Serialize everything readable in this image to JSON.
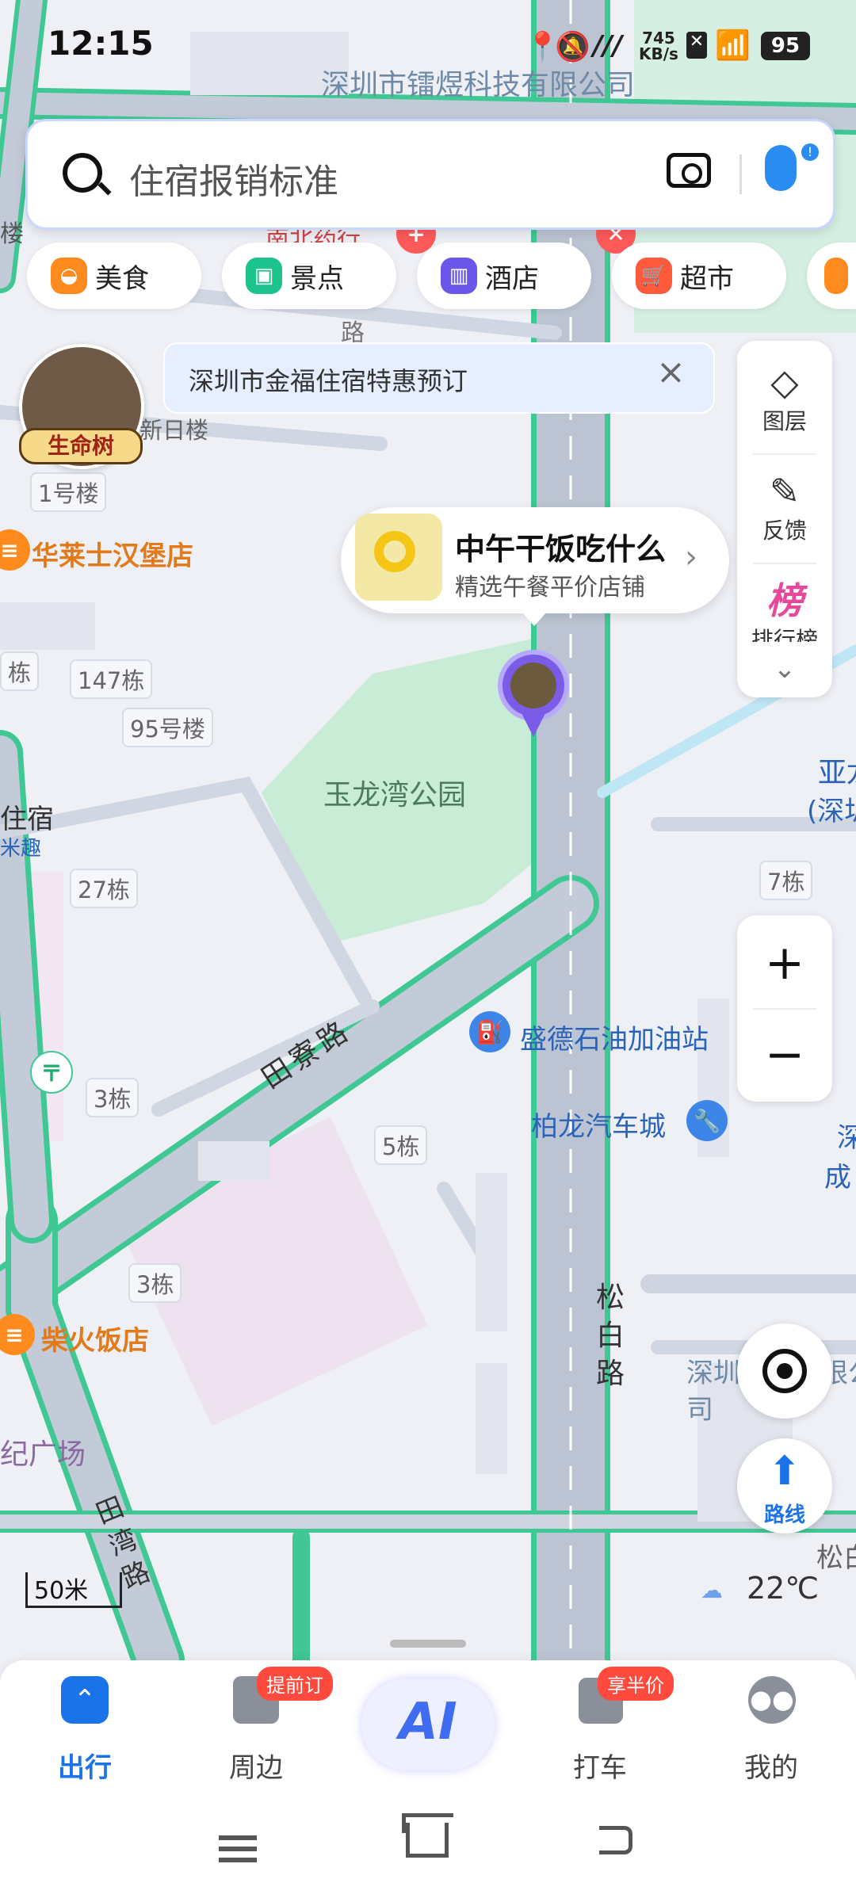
{
  "status_bar": {
    "time": "12:15",
    "net_speed": "745",
    "net_unit": "KB/s",
    "battery": "95"
  },
  "search": {
    "placeholder": "住宿报销标准"
  },
  "categories": [
    {
      "label": "美食",
      "color": "#ff8a1e",
      "icon": "food-icon"
    },
    {
      "label": "景点",
      "color": "#1cc38c",
      "icon": "scenic-icon"
    },
    {
      "label": "酒店",
      "color": "#6a56e8",
      "icon": "hotel-icon"
    },
    {
      "label": "超市",
      "color": "#ff5a3c",
      "icon": "supermarket-icon"
    }
  ],
  "promo_banner": {
    "text": "深圳市金福住宿特惠预订"
  },
  "movie_badge": {
    "label": "生命树"
  },
  "lunch_card": {
    "title": "中午干饭吃什么",
    "subtitle": "精选午餐平价店铺"
  },
  "right_panel": {
    "layers": "图层",
    "feedback": "反馈",
    "ranking_glyph": "榜",
    "ranking_label": "排行榜"
  },
  "map_labels": {
    "top_company": "深圳市镭煜科技有限公司",
    "nanbei": "南北药行",
    "lou": "楼",
    "road_top": "路",
    "xinri": "新日楼",
    "b1": "1号楼",
    "b147": "147栋",
    "b95": "95号楼",
    "dong": "栋",
    "zhusu": "住宿",
    "miqu": "米趣",
    "b27": "27栋",
    "b7": "7栋",
    "b3a": "3栋",
    "b5": "5栋",
    "b3b": "3栋",
    "park": "玉龙湾公园",
    "road_tianliao": "田寮路",
    "road_songbai": "松白路",
    "road_tianwan": "田湾路",
    "ya": "亚龙",
    "shen": "(深圳",
    "shen_right": "深",
    "cheng": "成",
    "company2": "深圳科技有限公司",
    "songbai_right": "松白",
    "jiguangchang": "纪广场"
  },
  "pois": {
    "burger": "华莱士汉堡店",
    "gas": "盛德石油加油站",
    "car": "柏龙汽车城",
    "chaihuo": "柴火饭店"
  },
  "map_controls": {
    "route": "路线",
    "scale": "50米",
    "temperature": "22℃"
  },
  "bottom_nav": {
    "tabs": [
      {
        "label": "出行",
        "active": true
      },
      {
        "label": "周边",
        "badge": "提前订"
      },
      {
        "label": "AI"
      },
      {
        "label": "打车",
        "badge": "享半价"
      },
      {
        "label": "我的"
      }
    ]
  },
  "colors": {
    "accent": "#1a73e8",
    "park": "#c9ecd6",
    "road_outline": "#3fc894"
  }
}
